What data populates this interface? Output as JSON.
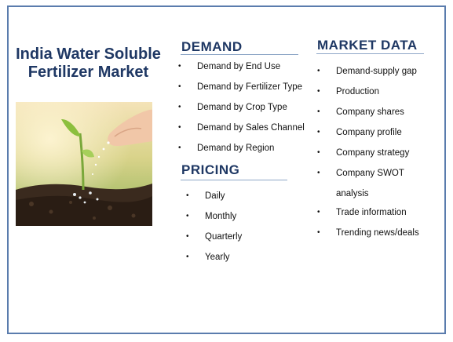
{
  "title": "India Water Soluble Fertilizer Market",
  "image": {
    "description_icon": "seedling-hand-photo"
  },
  "demand": {
    "heading": "DEMAND",
    "items": [
      "Demand by End Use",
      "Demand by Fertilizer Type",
      "Demand by Crop Type",
      "Demand by Sales Channel",
      "Demand by Region"
    ]
  },
  "pricing": {
    "heading": "PRICING",
    "items": [
      "Daily",
      "Monthly",
      "Quarterly",
      "Yearly"
    ]
  },
  "market_data": {
    "heading": "MARKET DATA",
    "items": [
      "Demand-supply gap",
      "Production",
      "Company shares",
      "Company profile",
      "Company strategy",
      "Company SWOT",
      "analysis",
      "Trade information",
      "Trending news/deals"
    ]
  },
  "colors": {
    "heading": "#1f3864",
    "border": "#5a7cad"
  }
}
